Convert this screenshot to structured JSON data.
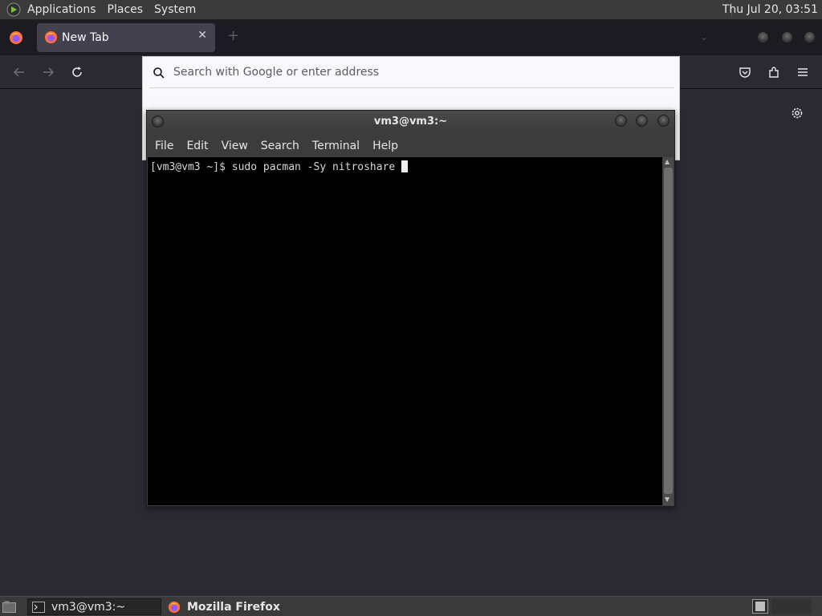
{
  "top_panel": {
    "menus": [
      "Applications",
      "Places",
      "System"
    ],
    "clock": "Thu Jul 20, 03:51"
  },
  "firefox": {
    "tab": {
      "label": "New Tab",
      "close": "✕"
    },
    "new_tab_symbol": "+",
    "url_placeholder": "Search with Google or enter address"
  },
  "terminal": {
    "title": "vm3@vm3:~",
    "menu": [
      "File",
      "Edit",
      "View",
      "Search",
      "Terminal",
      "Help"
    ],
    "prompt": "[vm3@vm3 ~]$ ",
    "command": "sudo pacman -Sy nitroshare "
  },
  "taskbar": {
    "items": [
      "vm3@vm3:~",
      "Mozilla Firefox"
    ]
  },
  "colors": {
    "panel": "#3a3a3a",
    "firefox_bg": "#2b2a33",
    "terminal_bg": "#000000",
    "firefox_orange": "#ff7139"
  }
}
